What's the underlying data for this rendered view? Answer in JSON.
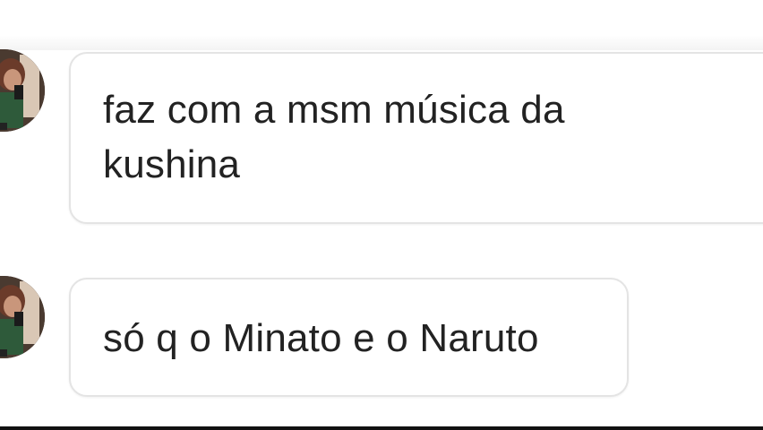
{
  "comments": [
    {
      "text": "faz com a msm música da\nkushina",
      "avatar_icon": "user-avatar-icon"
    },
    {
      "text": "só q o Minato e o Naruto",
      "avatar_icon": "user-avatar-icon"
    }
  ],
  "colors": {
    "bubble_border": "#e4e4e4",
    "text": "#222222",
    "background": "#ffffff"
  }
}
